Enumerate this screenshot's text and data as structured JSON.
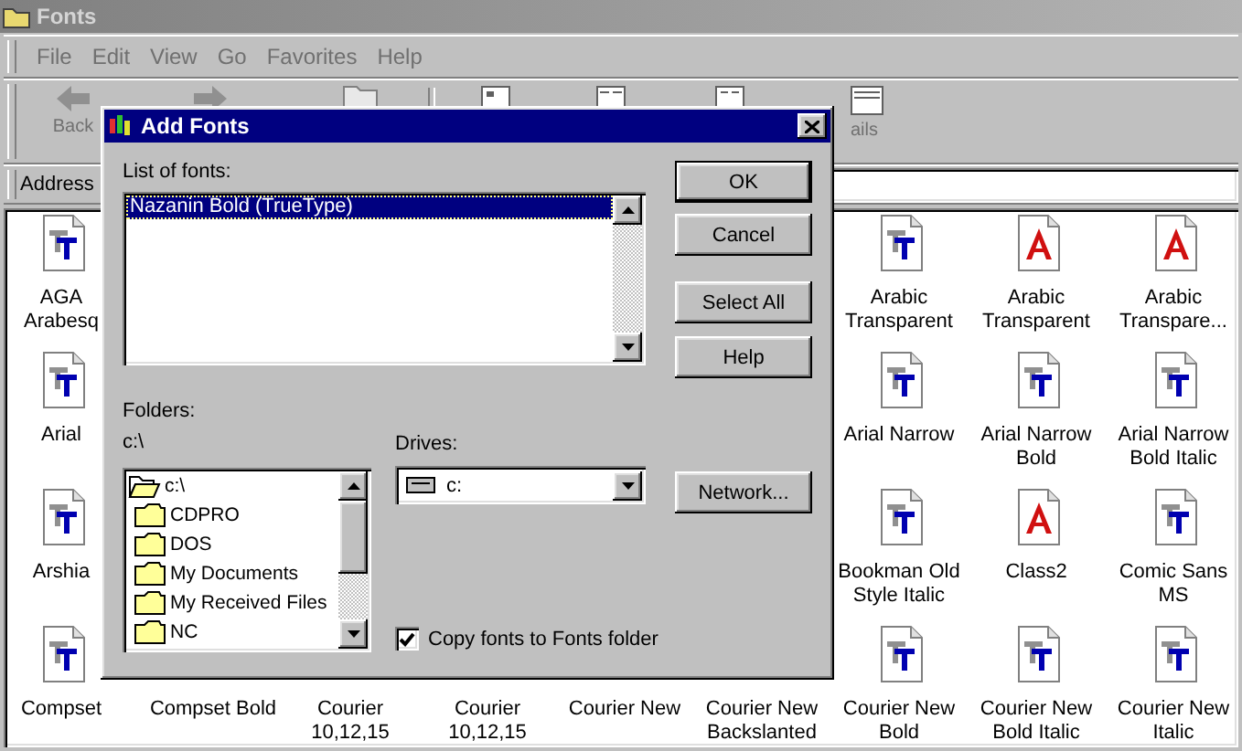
{
  "window": {
    "title": "Fonts"
  },
  "menu": [
    "File",
    "Edit",
    "View",
    "Go",
    "Favorites",
    "Help"
  ],
  "toolbar": [
    {
      "kind": "back",
      "label": "Back"
    },
    {
      "kind": "forward"
    },
    {
      "kind": "up"
    },
    {
      "kind": "separator"
    },
    {
      "kind": "large-icons"
    },
    {
      "kind": "small-icons"
    },
    {
      "kind": "list"
    },
    {
      "kind": "details",
      "label": "ails"
    }
  ],
  "address": {
    "label": "Address"
  },
  "icons": {
    "left_column": [
      {
        "label": "AGA Arabesq",
        "kind": "truetype"
      },
      {
        "label": "Arial",
        "kind": "truetype"
      },
      {
        "label": "Arshia",
        "kind": "truetype"
      },
      {
        "label": "Compset",
        "kind": "truetype"
      }
    ],
    "right_block": [
      {
        "label": "Arabic Transparent",
        "kind": "truetype"
      },
      {
        "label": "Arabic Transparent",
        "kind": "raster"
      },
      {
        "label": "Arabic Transpare...",
        "kind": "raster"
      },
      {
        "label": "Arial Narrow",
        "kind": "truetype"
      },
      {
        "label": "Arial Narrow Bold",
        "kind": "truetype"
      },
      {
        "label": "Arial Narrow Bold Italic",
        "kind": "truetype"
      },
      {
        "label": "Bookman Old Style Italic",
        "kind": "truetype"
      },
      {
        "label": "Class2",
        "kind": "raster"
      },
      {
        "label": "Comic Sans MS",
        "kind": "truetype"
      }
    ],
    "bottom_row": [
      {
        "label": "Compset Bold",
        "kind": "covered"
      },
      {
        "label": "Courier 10,12,15",
        "kind": "covered"
      },
      {
        "label": "Courier 10,12,15",
        "kind": "covered"
      },
      {
        "label": "Courier New",
        "kind": "covered"
      },
      {
        "label": "Courier New Backslanted",
        "kind": "covered"
      },
      {
        "label": "Courier New Bold",
        "kind": "truetype"
      },
      {
        "label": "Courier New Bold Italic",
        "kind": "truetype"
      },
      {
        "label": "Courier New Italic",
        "kind": "truetype"
      }
    ]
  },
  "dialog": {
    "title": "Add Fonts",
    "list_label": "List of fonts:",
    "fonts": [
      {
        "label": "Nazanin Bold (TrueType)",
        "selected": true
      }
    ],
    "buttons": [
      {
        "label": "OK",
        "default": true
      },
      {
        "label": "Cancel",
        "default": false
      },
      {
        "label": "Select All",
        "default": false
      },
      {
        "label": "Help",
        "default": false
      }
    ],
    "folders_label": "Folders:",
    "folder_path": "c:\\",
    "folders": [
      {
        "name": "c:\\",
        "kind": "open"
      },
      {
        "name": "CDPRO",
        "kind": "closed"
      },
      {
        "name": "DOS",
        "kind": "closed"
      },
      {
        "name": "My Documents",
        "kind": "closed"
      },
      {
        "name": "My Received Files",
        "kind": "closed"
      },
      {
        "name": "NC",
        "kind": "closed"
      }
    ],
    "drives_label": "Drives:",
    "drive": "c:",
    "network_button": "Network...",
    "copy_option": {
      "label": "Copy fonts to Fonts folder",
      "checked": true
    }
  }
}
